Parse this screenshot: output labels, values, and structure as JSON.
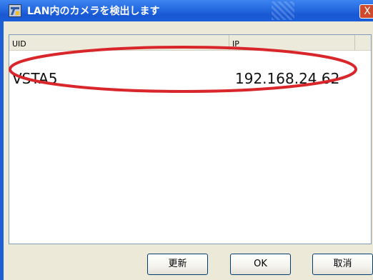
{
  "window": {
    "title": "LAN内のカメラを検出します",
    "close_label": "X"
  },
  "list": {
    "columns": [
      "UID",
      "IP"
    ],
    "rows": [
      {
        "uid": "VSTA5",
        "ip": "192.168.24.62"
      }
    ]
  },
  "buttons": {
    "refresh": "更新",
    "ok": "OK",
    "cancel": "取消"
  },
  "annotation": {
    "shape": "ellipse",
    "color": "#d8262b"
  },
  "colors": {
    "titlebar": "#1958d4",
    "dialog_bg": "#ece9d8",
    "list_bg": "#ffffff"
  }
}
